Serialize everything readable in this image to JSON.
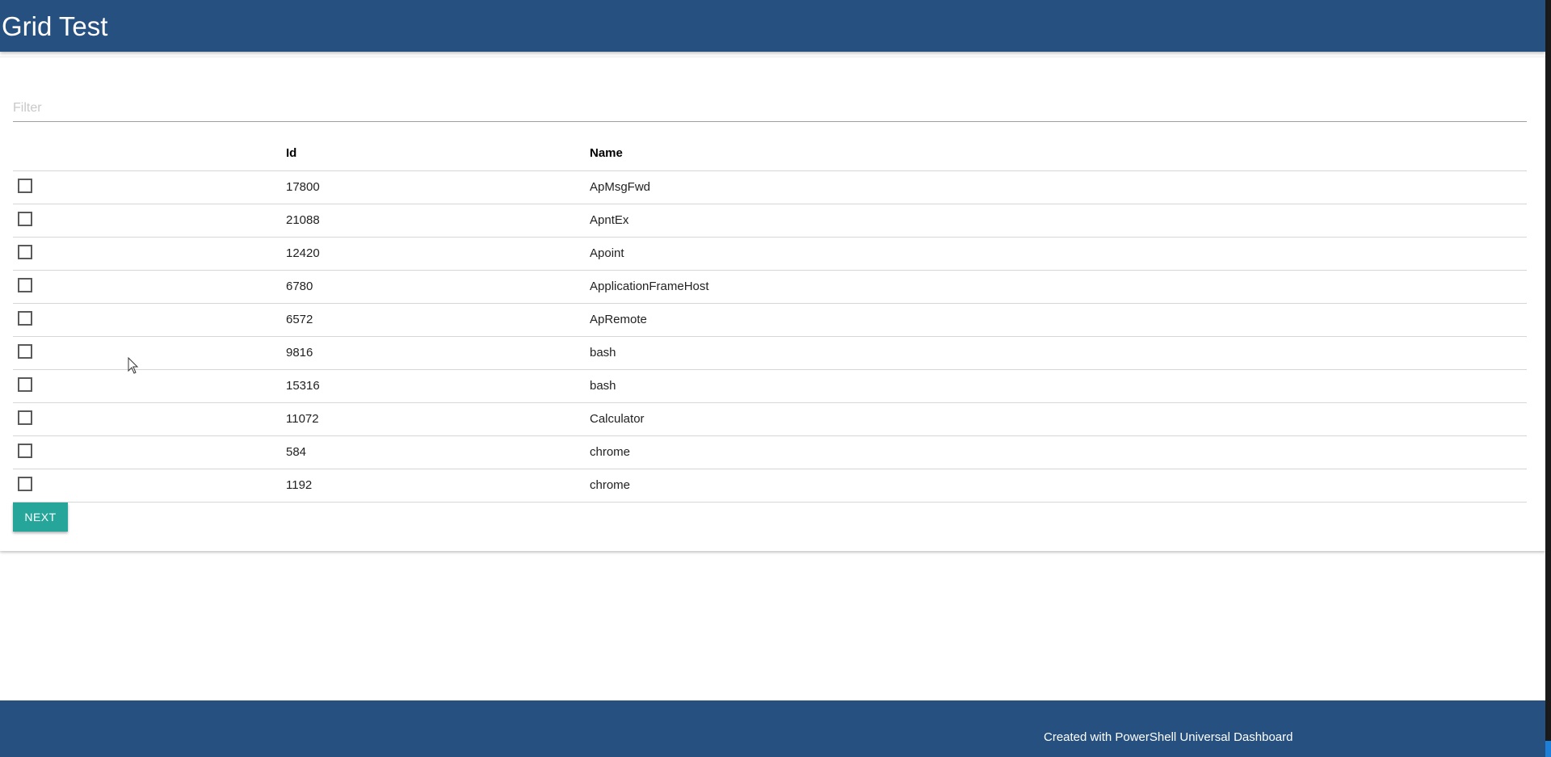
{
  "header": {
    "title": "Grid Test",
    "background": "#26507f"
  },
  "filter": {
    "placeholder": "Filter",
    "value": ""
  },
  "grid": {
    "columns": [
      "",
      "Id",
      "Name"
    ],
    "rows": [
      {
        "id": "17800",
        "name": "ApMsgFwd",
        "checked": false
      },
      {
        "id": "21088",
        "name": "ApntEx",
        "checked": false
      },
      {
        "id": "12420",
        "name": "Apoint",
        "checked": false
      },
      {
        "id": "6780",
        "name": "ApplicationFrameHost",
        "checked": false
      },
      {
        "id": "6572",
        "name": "ApRemote",
        "checked": false
      },
      {
        "id": "9816",
        "name": "bash",
        "checked": false
      },
      {
        "id": "15316",
        "name": "bash",
        "checked": false
      },
      {
        "id": "11072",
        "name": "Calculator",
        "checked": false
      },
      {
        "id": "584",
        "name": "chrome",
        "checked": false
      },
      {
        "id": "1192",
        "name": "chrome",
        "checked": false
      }
    ]
  },
  "pagination": {
    "next_label": "NEXT",
    "button_color": "#26a69a"
  },
  "footer": {
    "text": "Created with PowerShell Universal Dashboard"
  },
  "icons": {
    "cursor": "mouse-pointer-icon",
    "checkbox": "checkbox-unchecked-icon"
  }
}
